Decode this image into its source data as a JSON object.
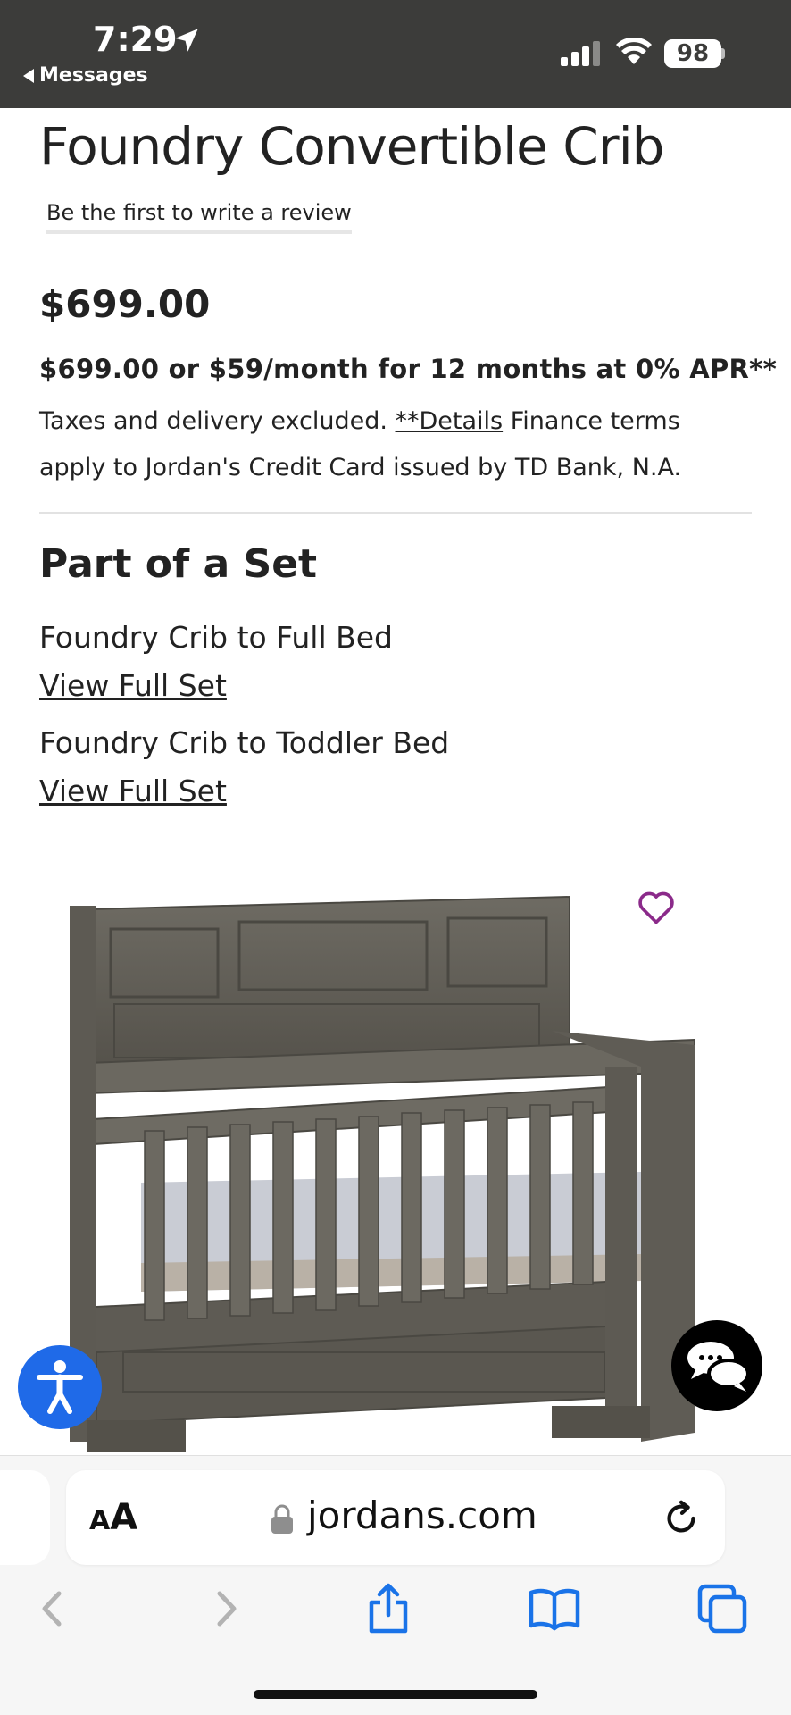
{
  "status_bar": {
    "time": "7:29",
    "back_label": "Messages",
    "battery": "98"
  },
  "product": {
    "title": "Foundry Convertible Crib",
    "review_link": "Be the first to write a review",
    "price": "$699.00",
    "finance_offer": "$699.00 or $59/month for 12 months at 0% APR**",
    "finance_note_prefix": "Taxes and delivery excluded. ",
    "finance_details_link": "**Details",
    "finance_note_suffix": " Finance terms apply to Jordan's Credit Card issued by TD Bank, N.A."
  },
  "set": {
    "heading": "Part of a Set",
    "items": [
      {
        "name": "Foundry Crib to Full Bed",
        "link": "View Full Set"
      },
      {
        "name": "Foundry Crib to Toddler Bed",
        "link": "View Full Set"
      }
    ]
  },
  "browser": {
    "aa_large": "A",
    "aa_small": "A",
    "url": "jordans.com"
  },
  "icons": {
    "wishlist": "heart-outline-icon",
    "accessibility": "accessibility-icon",
    "chat": "chat-bubbles-icon",
    "location": "location-arrow-icon",
    "lock": "lock-icon",
    "reload": "reload-icon",
    "back": "chevron-left-icon",
    "forward": "chevron-right-icon",
    "share": "share-icon",
    "bookmarks": "book-icon",
    "tabs": "tabs-icon"
  },
  "colors": {
    "status_bar_bg": "#3c3c3a",
    "wishlist_heart": "#8b2a8a",
    "accessibility_bg": "#1f6ae8",
    "safari_blue": "#1a73e8",
    "nav_disabled": "#b3b3b3"
  }
}
